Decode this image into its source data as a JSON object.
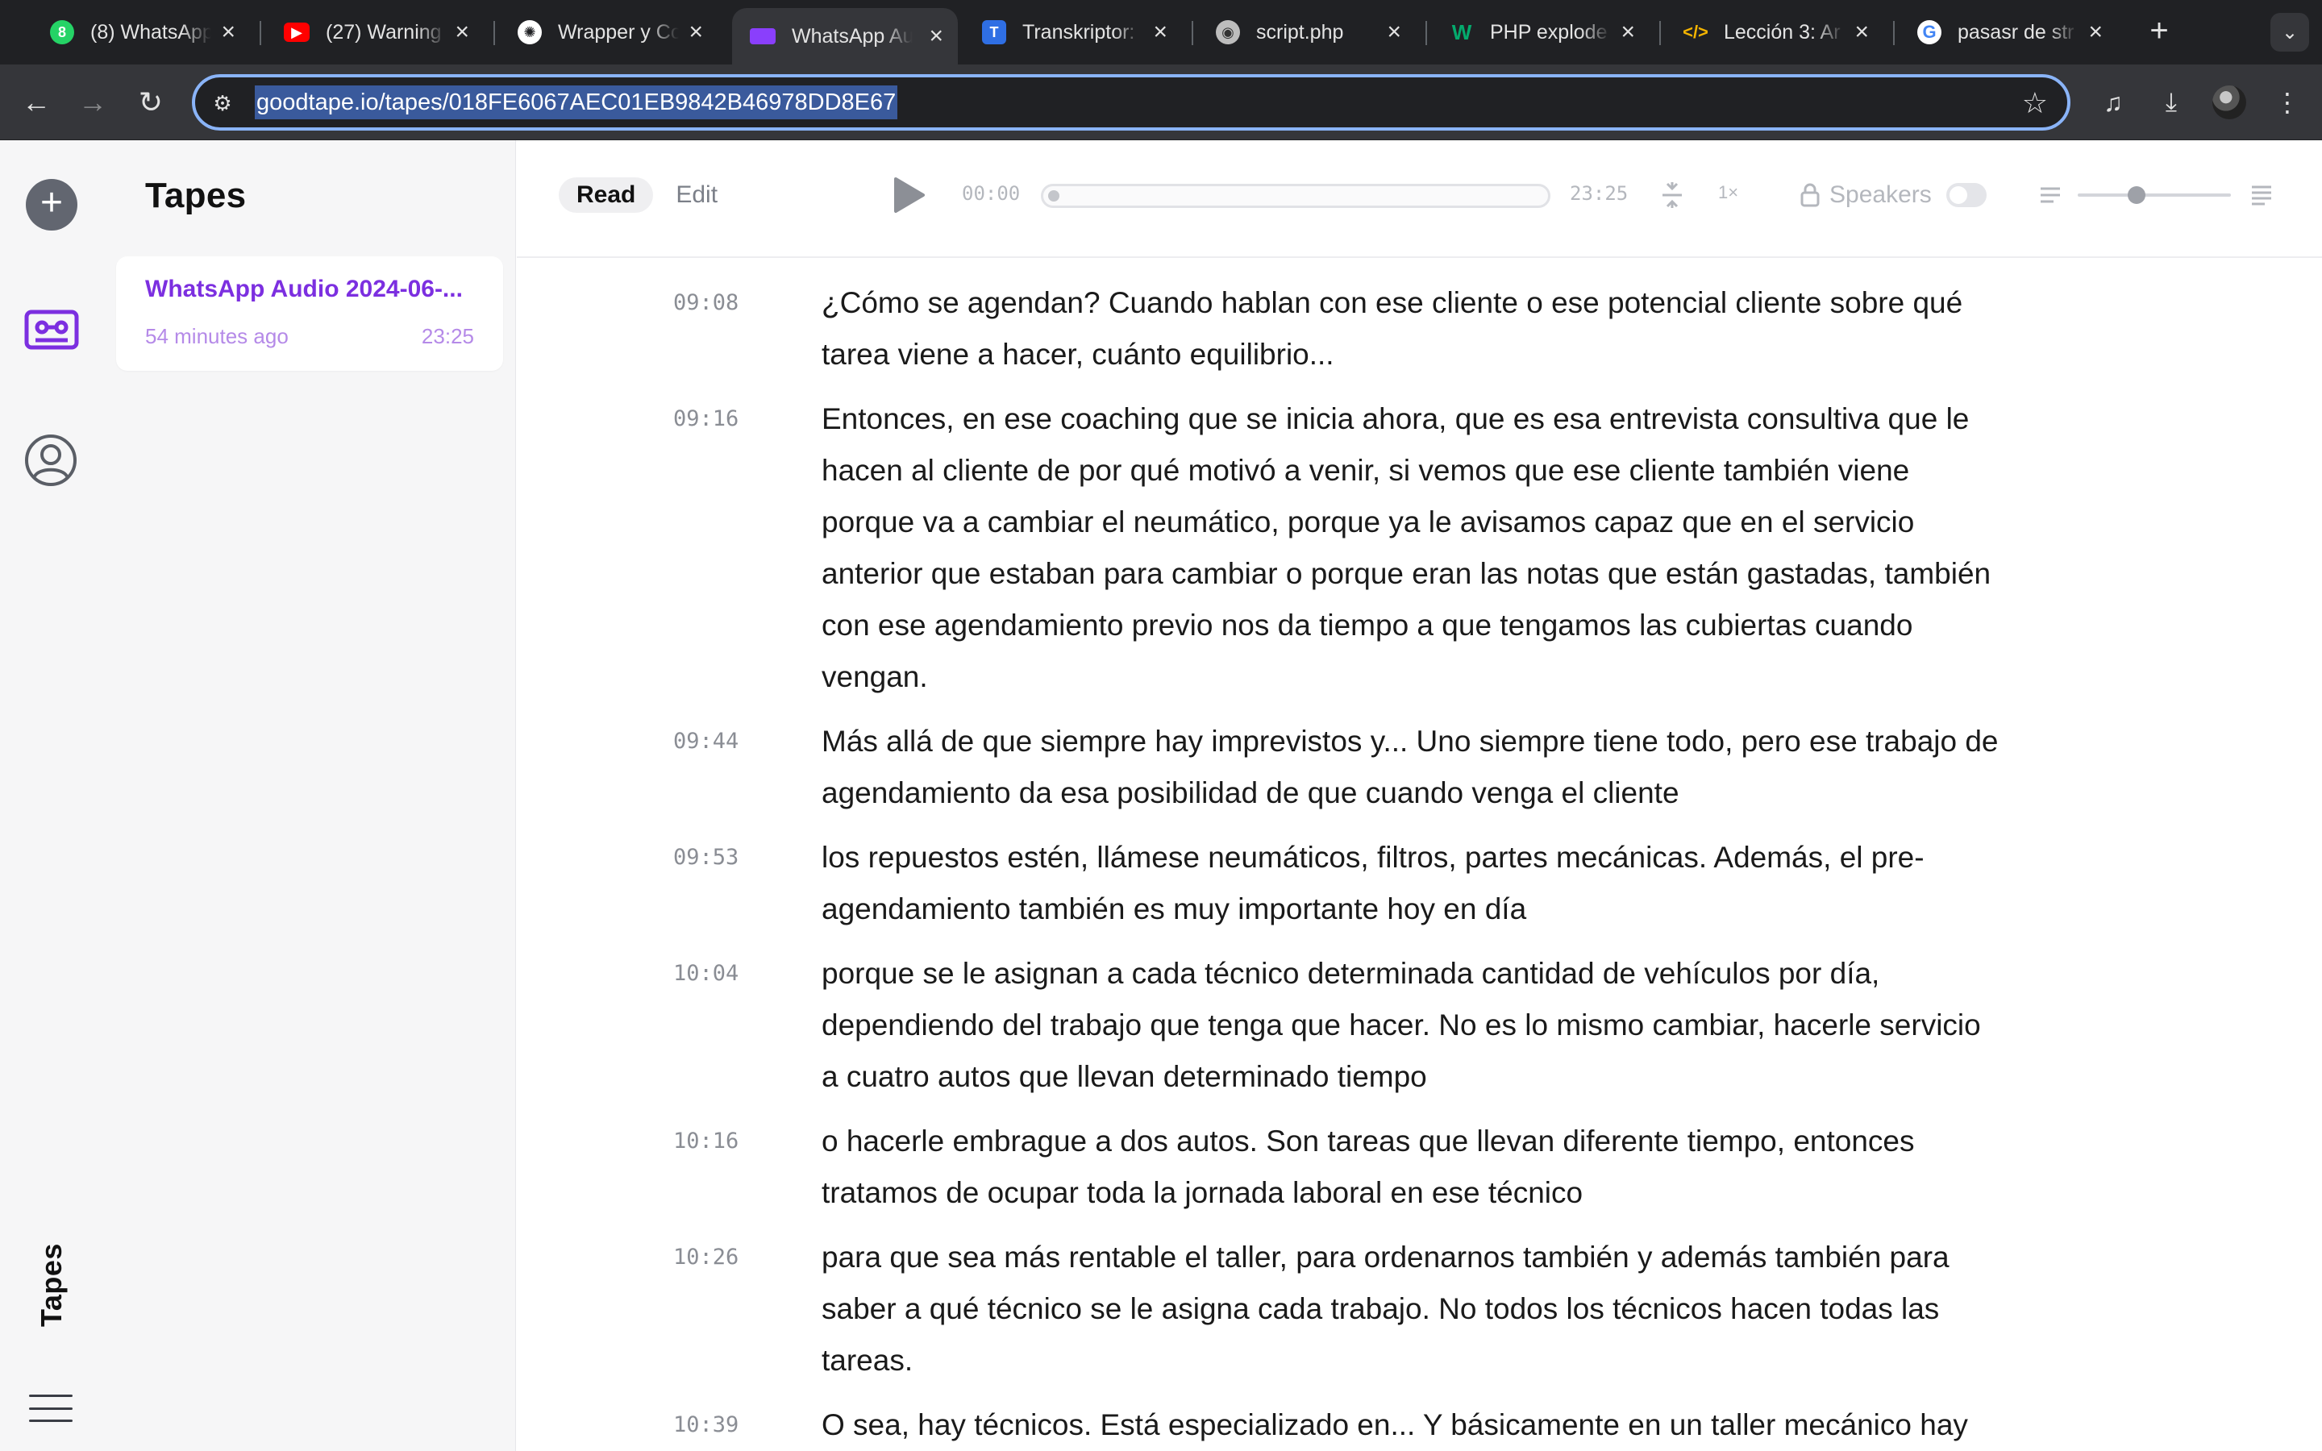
{
  "browser": {
    "tabs": [
      {
        "title": "(8) WhatsApp",
        "icon": "whatsapp-icon",
        "color": "#25d366"
      },
      {
        "title": "(27) Warning",
        "icon": "youtube-icon",
        "color": "#ff0000"
      },
      {
        "title": "Wrapper y Co",
        "icon": "openai-icon",
        "color": "#ffffff"
      },
      {
        "title": "WhatsApp Au",
        "icon": "goodtape-icon",
        "color": "#8a3ffc"
      },
      {
        "title": "Transkriptor:",
        "icon": "transkriptor-icon",
        "color": "#2f6fe4"
      },
      {
        "title": "script.php",
        "icon": "php-icon",
        "color": "#bdbdbd"
      },
      {
        "title": "PHP explode",
        "icon": "w3schools-icon",
        "color": "#04aa6d"
      },
      {
        "title": "Lección 3: Ar",
        "icon": "code-icon",
        "color": "#f4b400"
      },
      {
        "title": "pasasr de str",
        "icon": "google-icon",
        "color": "#4285f4"
      }
    ],
    "active_tab": 3,
    "url": "goodtape.io/tapes/018FE6067AEC01EB9842B46978DD8E67"
  },
  "sidebar": {
    "vertical_label": "Tapes"
  },
  "tapes_panel": {
    "title": "Tapes",
    "items": [
      {
        "title": "WhatsApp Audio 2024-06-...",
        "age": "54 minutes ago",
        "duration": "23:25"
      }
    ]
  },
  "player": {
    "modes": [
      "Read",
      "Edit"
    ],
    "active_mode": "Read",
    "current_time": "00:00",
    "total_time": "23:25",
    "progress": 0,
    "speed": "1×",
    "speakers_label": "Speakers",
    "speakers_enabled": false
  },
  "transcript": [
    {
      "time": "09:08",
      "text": "¿Cómo se agendan? Cuando hablan con ese cliente o ese potencial cliente sobre qué tarea viene a hacer, cuánto equilibrio..."
    },
    {
      "time": "09:16",
      "text": "Entonces, en ese coaching que se inicia ahora, que es esa entrevista consultiva que le hacen al cliente de por qué motivó a venir, si vemos que ese cliente también viene porque va a cambiar el neumático, porque ya le avisamos capaz que en el servicio anterior que estaban para cambiar o porque eran las notas que están gastadas, también con ese agendamiento previo nos da tiempo a que tengamos las cubiertas cuando vengan."
    },
    {
      "time": "09:44",
      "text": "Más allá de que siempre hay imprevistos y... Uno siempre tiene todo, pero ese trabajo de agendamiento da esa posibilidad de que cuando venga el cliente"
    },
    {
      "time": "09:53",
      "text": "los repuestos estén, llámese neumáticos, filtros, partes mecánicas. Además, el pre-agendamiento también es muy importante hoy en día"
    },
    {
      "time": "10:04",
      "text": "porque se le asignan a cada técnico determinada cantidad de vehículos por día, dependiendo del trabajo que tenga que hacer. No es lo mismo cambiar, hacerle servicio a cuatro autos que llevan determinado tiempo"
    },
    {
      "time": "10:16",
      "text": "o hacerle embrague a dos autos. Son tareas que llevan diferente tiempo, entonces tratamos de ocupar toda la jornada laboral en ese técnico"
    },
    {
      "time": "10:26",
      "text": "para que sea más rentable el taller, para ordenarnos también y además también para saber a qué técnico se le asigna cada trabajo. No todos los técnicos hacen todas las tareas."
    },
    {
      "time": "10:39",
      "text": "O sea, hay técnicos. Está especializado en... Y básicamente en un taller mecánico hay"
    }
  ],
  "colors": {
    "accent": "#7c2fe0",
    "accent_light": "#b58ae8",
    "chrome_dark": "#202124",
    "chrome_mid": "#35363a",
    "omnibox_focus": "#8ab4f8"
  }
}
